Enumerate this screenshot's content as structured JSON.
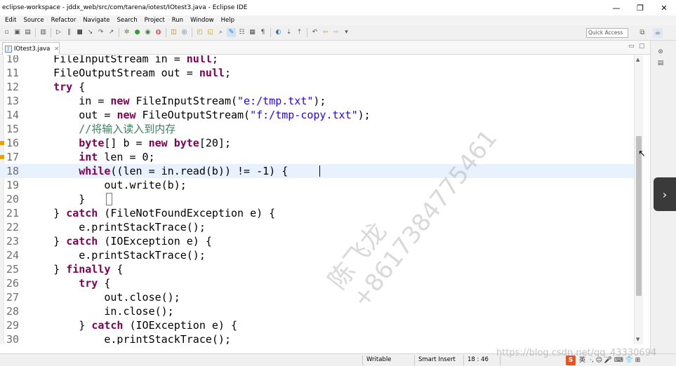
{
  "window": {
    "title": "eclipse-workspace - jddx_web/src/com/tarena/iotest/IOtest3.java - Eclipse IDE",
    "minimize_glyph": "—",
    "maximize_glyph": "❐",
    "close_glyph": "✕"
  },
  "menu": [
    "Edit",
    "Source",
    "Refactor",
    "Navigate",
    "Search",
    "Project",
    "Run",
    "Window",
    "Help"
  ],
  "toolbar": {
    "quick_access": "Quick Access",
    "icons": [
      "new-icon",
      "save-icon",
      "save-all-icon",
      "print-icon",
      "debug-icon",
      "run-icon",
      "coverage-icon",
      "external-tools-icon",
      "new-package-icon",
      "new-class-icon",
      "open-type-icon",
      "search-icon",
      "toggle-mark-icon",
      "annotation-icon",
      "back-icon",
      "forward-icon"
    ]
  },
  "editor_tab": {
    "file_name": "IOtest3.java",
    "close_glyph": "✕"
  },
  "code": {
    "lines": [
      {
        "n": "10",
        "parts": [
          [
            "plain",
            "    FileInputStream in = "
          ],
          [
            "kw",
            "null"
          ],
          [
            "plain",
            ";"
          ]
        ]
      },
      {
        "n": "11",
        "parts": [
          [
            "plain",
            "    FileOutputStream out = "
          ],
          [
            "kw",
            "null"
          ],
          [
            "plain",
            ";"
          ]
        ]
      },
      {
        "n": "12",
        "parts": [
          [
            "plain",
            "    "
          ],
          [
            "kw",
            "try"
          ],
          [
            "plain",
            " {"
          ]
        ]
      },
      {
        "n": "13",
        "parts": [
          [
            "plain",
            "        in = "
          ],
          [
            "kw",
            "new"
          ],
          [
            "plain",
            " FileInputStream("
          ],
          [
            "str",
            "\"e:/tmp.txt\""
          ],
          [
            "plain",
            ");"
          ]
        ]
      },
      {
        "n": "14",
        "parts": [
          [
            "plain",
            "        out = "
          ],
          [
            "kw",
            "new"
          ],
          [
            "plain",
            " FileOutputStream("
          ],
          [
            "str",
            "\"f:/tmp-copy.txt\""
          ],
          [
            "plain",
            ");"
          ]
        ]
      },
      {
        "n": "15",
        "parts": [
          [
            "plain",
            "        "
          ],
          [
            "cmt",
            "//将输入读入到内存"
          ]
        ]
      },
      {
        "n": "16",
        "parts": [
          [
            "plain",
            "        "
          ],
          [
            "kw",
            "byte"
          ],
          [
            "plain",
            "[] b = "
          ],
          [
            "kw",
            "new"
          ],
          [
            "plain",
            " "
          ],
          [
            "kw",
            "byte"
          ],
          [
            "plain",
            "[20];"
          ]
        ]
      },
      {
        "n": "17",
        "parts": [
          [
            "plain",
            "        "
          ],
          [
            "kw",
            "int"
          ],
          [
            "plain",
            " len = 0;"
          ]
        ]
      },
      {
        "n": "18",
        "parts": [
          [
            "plain",
            "        "
          ],
          [
            "kw",
            "while"
          ],
          [
            "plain",
            "((len = in.read(b)) != -1) {"
          ]
        ]
      },
      {
        "n": "19",
        "parts": [
          [
            "plain",
            "            out.write(b);"
          ]
        ]
      },
      {
        "n": "20",
        "parts": [
          [
            "plain",
            "        }"
          ]
        ]
      },
      {
        "n": "21",
        "parts": [
          [
            "plain",
            "    } "
          ],
          [
            "kw",
            "catch"
          ],
          [
            "plain",
            " (FileNotFoundException e) {"
          ]
        ]
      },
      {
        "n": "22",
        "parts": [
          [
            "plain",
            "        e.printStackTrace();"
          ]
        ]
      },
      {
        "n": "23",
        "parts": [
          [
            "plain",
            "    } "
          ],
          [
            "kw",
            "catch"
          ],
          [
            "plain",
            " (IOException e) {"
          ]
        ]
      },
      {
        "n": "24",
        "parts": [
          [
            "plain",
            "        e.printStackTrace();"
          ]
        ]
      },
      {
        "n": "25",
        "parts": [
          [
            "plain",
            "    } "
          ],
          [
            "kw",
            "finally"
          ],
          [
            "plain",
            " {"
          ]
        ]
      },
      {
        "n": "26",
        "parts": [
          [
            "plain",
            "        "
          ],
          [
            "kw",
            "try"
          ],
          [
            "plain",
            " {"
          ]
        ]
      },
      {
        "n": "27",
        "parts": [
          [
            "plain",
            "            out.close();"
          ]
        ]
      },
      {
        "n": "28",
        "parts": [
          [
            "plain",
            "            in.close();"
          ]
        ]
      },
      {
        "n": "29",
        "parts": [
          [
            "plain",
            "        } "
          ],
          [
            "kw",
            "catch"
          ],
          [
            "plain",
            " (IOException e) {"
          ]
        ]
      },
      {
        "n": "30",
        "parts": [
          [
            "plain",
            "            e.printStackTrace();"
          ]
        ]
      }
    ],
    "current_line": "18"
  },
  "status": {
    "writable": "Writable",
    "insert_mode": "Smart Insert",
    "position": "18 : 46"
  },
  "ime": {
    "logo": "S",
    "lang": "英",
    "icons": "·, ☺ 🎤 ⌨ 👕 ⊞"
  },
  "watermark": {
    "name": "陈飞龙",
    "phone": "+8617384775461",
    "url": "https://blog.csdn.net/qq_43330694"
  },
  "colors": {
    "keyword": "#7f0055",
    "string": "#2a00ff",
    "comment": "#3f7f5f",
    "current_line": "#e8f2fe"
  }
}
